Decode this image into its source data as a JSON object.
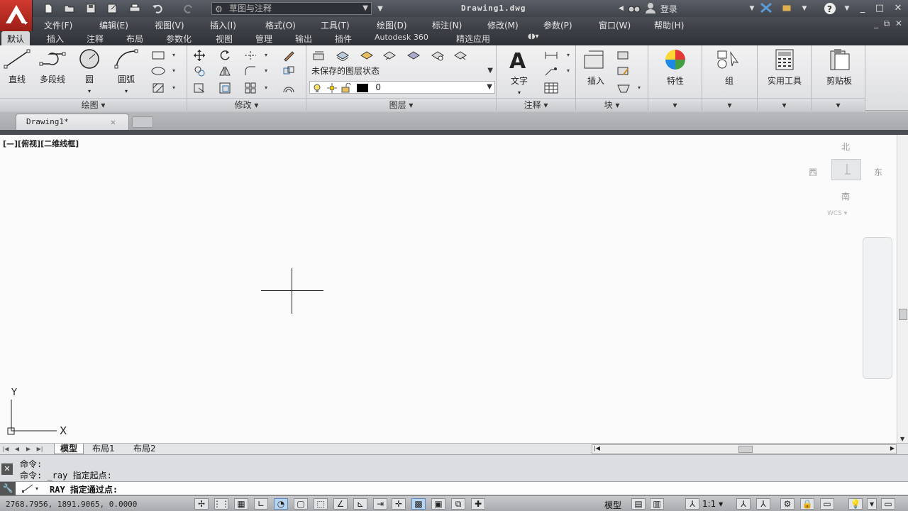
{
  "titlebar": {
    "workspace": "草图与注释",
    "document_title": "Drawing1.dwg",
    "login": "登录"
  },
  "menu": [
    "文件(F)",
    "编辑(E)",
    "视图(V)",
    "插入(I)",
    "格式(O)",
    "工具(T)",
    "绘图(D)",
    "标注(N)",
    "修改(M)",
    "参数(P)",
    "窗口(W)",
    "帮助(H)"
  ],
  "ribbon_tabs": [
    "默认",
    "插入",
    "注释",
    "布局",
    "参数化",
    "视图",
    "管理",
    "输出",
    "插件",
    "Autodesk 360",
    "精选应用"
  ],
  "panels": {
    "draw": {
      "title": "绘图",
      "line": "直线",
      "polyline": "多段线",
      "circle": "圆",
      "arc": "圆弧"
    },
    "modify": {
      "title": "修改"
    },
    "layers": {
      "title": "图层",
      "layer_state": "未保存的图层状态",
      "current_layer": "0"
    },
    "annotation": {
      "title": "注释",
      "text": "文字"
    },
    "block": {
      "title": "块",
      "insert": "插入"
    },
    "properties": {
      "label": "特性"
    },
    "groups": {
      "label": "组"
    },
    "utilities": {
      "label": "实用工具"
    },
    "clipboard": {
      "label": "剪贴板"
    }
  },
  "doc_tab": {
    "name": "Drawing1*"
  },
  "viewport": {
    "label": "[—][俯视][二维线框]",
    "viewcube": {
      "north": "北",
      "south": "南",
      "east": "东",
      "west": "西",
      "wcs": "WCS"
    }
  },
  "ucs": {
    "y": "Y",
    "x": "X"
  },
  "layout_tabs": [
    "模型",
    "布局1",
    "布局2"
  ],
  "command": {
    "history": [
      "命令:",
      "命令: _ray 指定起点:"
    ],
    "prompt": "RAY 指定通过点:"
  },
  "status": {
    "coords": "2768.7956, 1891.9065, 0.0000",
    "model": "模型",
    "scale": "1:1"
  },
  "colors": {
    "accent_red": "#c0302a",
    "layer_color": "#000000"
  }
}
